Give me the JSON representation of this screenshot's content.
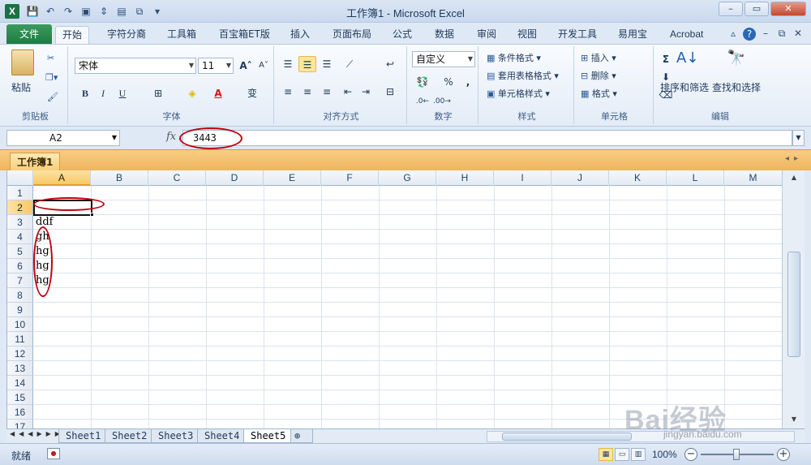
{
  "window": {
    "app_icon": "X",
    "title": "工作簿1 - Microsoft Excel",
    "minimize": "–",
    "maximize": "▭",
    "close": "✕"
  },
  "ribbon_tabs": [
    "文件",
    "开始",
    "字符分裔",
    "工具箱",
    "百宝箱ET版",
    "插入",
    "页面布局",
    "公式",
    "数据",
    "审阅",
    "视图",
    "开发工具",
    "易用宝",
    "Acrobat"
  ],
  "active_tab": "开始",
  "clipboard": {
    "paste": "粘贴",
    "label": "剪贴板"
  },
  "font": {
    "name": "宋体",
    "size": "11",
    "bold": "B",
    "italic": "I",
    "underline": "U",
    "grow": "A",
    "shrink": "A",
    "label": "字体"
  },
  "alignment": {
    "label": "对齐方式"
  },
  "number": {
    "format": "自定义",
    "percent": "%",
    "comma": ",",
    "label": "数字"
  },
  "styles": {
    "conditional": "条件格式",
    "table": "套用表格格式",
    "cell": "单元格样式",
    "label": "样式"
  },
  "cells": {
    "insert": "插入",
    "delete": "删除",
    "format": "格式",
    "label": "单元格"
  },
  "editing": {
    "sort": "排序和筛选",
    "find": "查找和选择",
    "sigma": "Σ",
    "label": "编辑"
  },
  "formula_bar": {
    "name_box": "A2",
    "fx": "fx",
    "value": "3443"
  },
  "workbook_tab": "工作簿1",
  "columns": [
    "A",
    "B",
    "C",
    "D",
    "E",
    "F",
    "G",
    "H",
    "I",
    "J",
    "K",
    "L",
    "M"
  ],
  "rows": [
    "1",
    "2",
    "3",
    "4",
    "5",
    "6",
    "7",
    "8",
    "9",
    "10",
    "11",
    "12",
    "13",
    "14",
    "15",
    "16",
    "17"
  ],
  "cell_values": {
    "A3": "ddf",
    "A4": "gh",
    "A5": "hg",
    "A6": "hg",
    "A7": "hg"
  },
  "sheets": [
    "Sheet1",
    "Sheet2",
    "Sheet3",
    "Sheet4",
    "Sheet5"
  ],
  "active_sheet": "Sheet5",
  "status": {
    "ready": "就绪",
    "zoom": "100%"
  },
  "watermark": {
    "brand": "Bai经验",
    "url": "jingyan.baidu.com"
  },
  "colors": {
    "file_tab": "#1e7c42",
    "annotation": "#c0000e",
    "selection": "#f7c865"
  }
}
